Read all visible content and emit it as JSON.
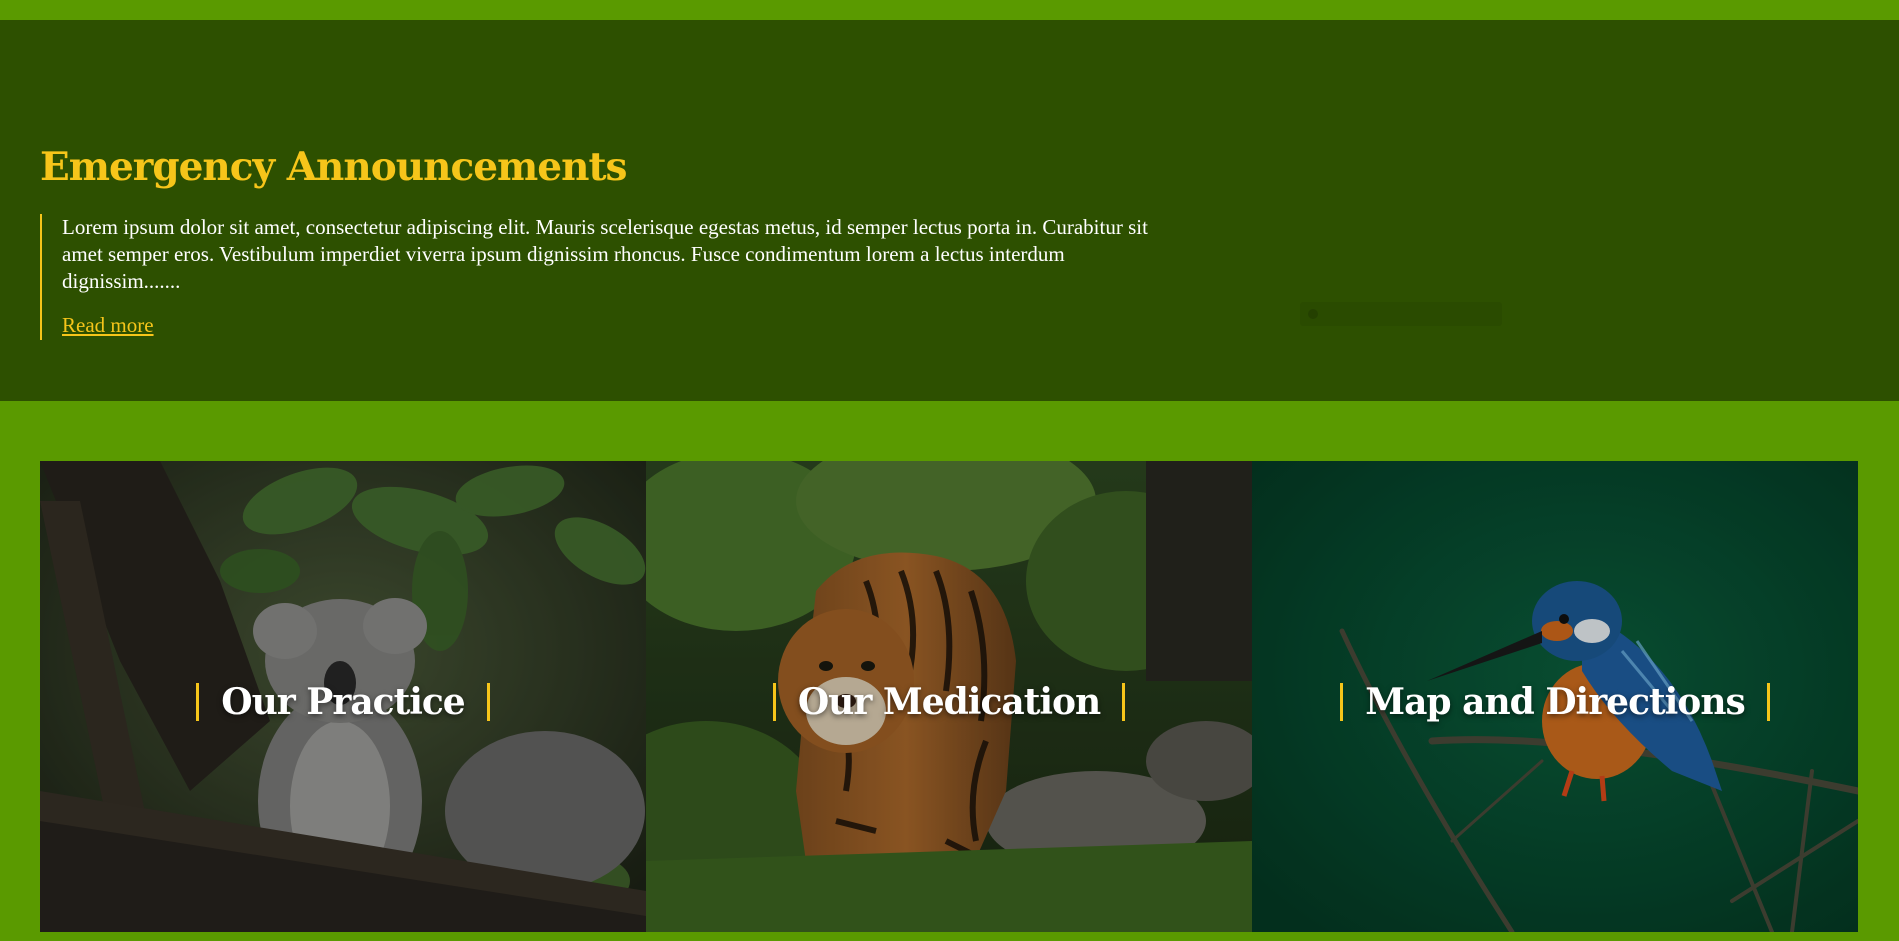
{
  "announcement": {
    "title": "Emergency Announcements",
    "text": "Lorem ipsum dolor sit amet, consectetur adipiscing elit. Mauris scelerisque egestas metus, id semper lectus porta in. Curabitur sit amet semper eros. Vestibulum imperdiet viverra ipsum dignissim rhoncus. Fusce condimentum lorem a lectus interdum dignissim.......",
    "read_more": "Read more"
  },
  "cards": [
    {
      "title": "Our Practice",
      "image": "koala-photo"
    },
    {
      "title": "Our Medication",
      "image": "tiger-photo"
    },
    {
      "title": "Map and Directions",
      "image": "kingfisher-photo"
    }
  ],
  "colors": {
    "page_background": "#5a9a00",
    "announcement_background": "#2d5000",
    "accent": "#f6c51a",
    "text_light": "#ffffff"
  }
}
